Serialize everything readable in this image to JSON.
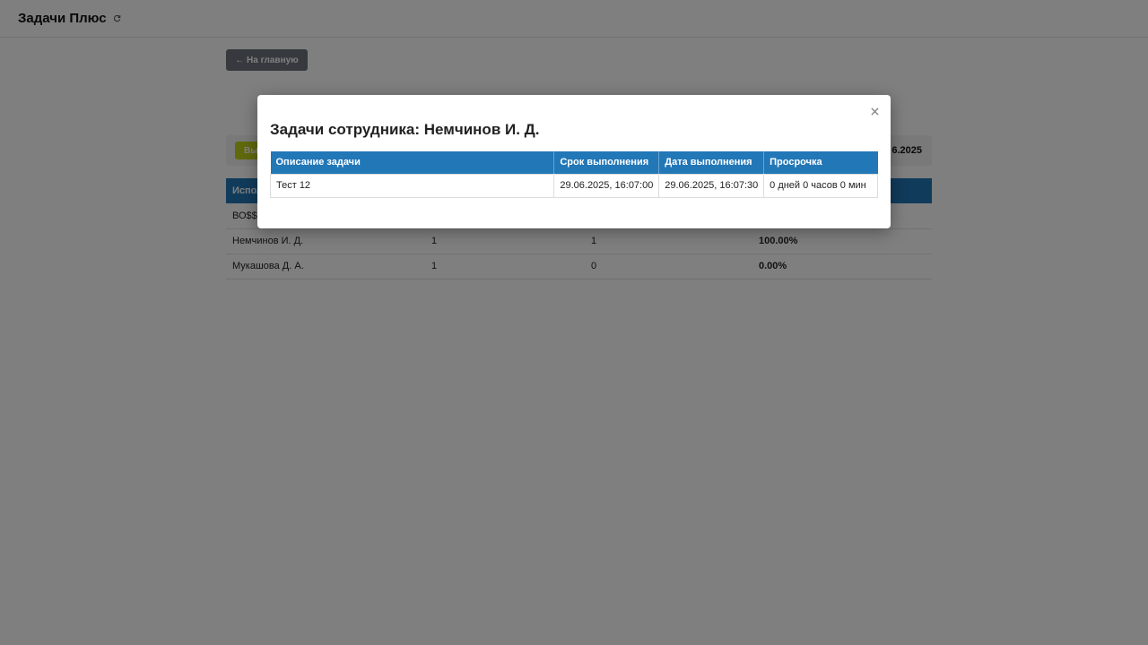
{
  "header": {
    "title": "Задачи Плюс",
    "refresh_icon": "refresh-icon"
  },
  "page": {
    "back_label": "← На главную",
    "export_label": "Вы",
    "period_text": "6.2025",
    "table": {
      "headers": [
        "Испол",
        "",
        "",
        ""
      ],
      "rows": [
        {
          "name": "ВО$$",
          "total": "",
          "overdue": "",
          "percent": ""
        },
        {
          "name": "Немчинов И. Д.",
          "total": "1",
          "overdue": "1",
          "percent": "100.00%"
        },
        {
          "name": "Мукашова Д. А.",
          "total": "1",
          "overdue": "0",
          "percent": "0.00%"
        }
      ]
    }
  },
  "modal": {
    "title": "Задачи сотрудника: Немчинов И. Д.",
    "close_label": "×",
    "headers": [
      "Описание задачи",
      "Срок выполнения",
      "Дата выполнения",
      "Просрочка"
    ],
    "rows": [
      {
        "description": "Тест 12",
        "deadline": "29.06.2025, 16:07:00",
        "completed": "29.06.2025, 16:07:30",
        "overdue": "0 дней 0 часов 0 мин"
      }
    ]
  },
  "colors": {
    "table_header": "#2277b7",
    "percent_bad": "#d42020",
    "percent_good": "#2a9d2a",
    "export_button": "#c2d21b"
  }
}
